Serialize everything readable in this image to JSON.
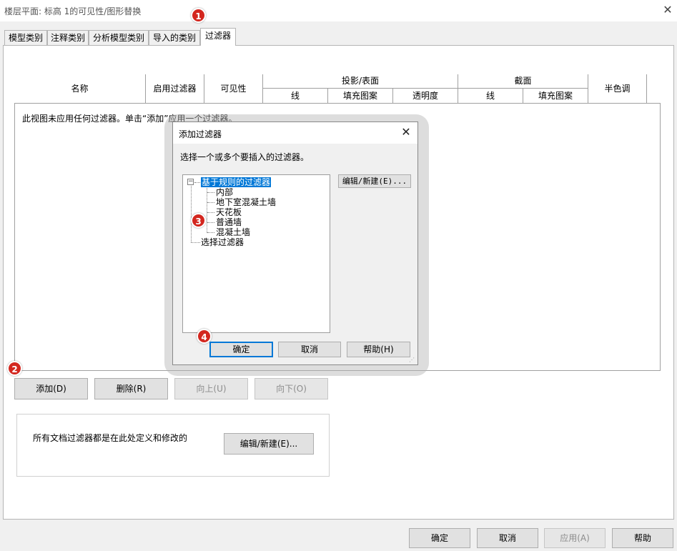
{
  "window": {
    "title": "楼层平面: 标高 1的可见性/图形替换"
  },
  "tabs": [
    "模型类别",
    "注释类别",
    "分析模型类别",
    "导入的类别",
    "过滤器"
  ],
  "table": {
    "headers": {
      "name": "名称",
      "enable_filter": "启用过滤器",
      "visibility": "可见性",
      "projection_surface": "投影/表面",
      "lines": "线",
      "fill_pattern": "填充图案",
      "transparency": "透明度",
      "section": "截面",
      "section_lines": "线",
      "section_fill_pattern": "填充图案",
      "halftone": "半色调"
    },
    "empty_message": "此视图未应用任何过滤器。单击“添加”应用一个过滤器。"
  },
  "buttons": {
    "add": "添加(D)",
    "delete": "删除(R)",
    "up": "向上(U)",
    "down": "向下(O)",
    "edit_new": "编辑/新建(E)...",
    "ok": "确定",
    "cancel": "取消",
    "apply": "应用(A)",
    "help": "帮助"
  },
  "groupbox": {
    "text": "所有文档过滤器都是在此处定义和修改的"
  },
  "dialog": {
    "title": "添加过滤器",
    "instruction": "选择一个或多个要插入的过滤器。",
    "tree": {
      "rule_group": "基于规则的过滤器",
      "rule_children": [
        "内部",
        "地下室混凝土墙",
        "天花板",
        "普通墙",
        "混凝土墙"
      ],
      "selection_group": "选择过滤器"
    },
    "edit_new": "编辑/新建(E)...",
    "ok": "确定",
    "cancel": "取消",
    "help": "帮助(H)"
  },
  "badges": [
    "1",
    "2",
    "3",
    "4"
  ],
  "colors": {
    "badge": "#d3271f",
    "selection": "#0078d7",
    "focus_border": "#0078d7"
  }
}
